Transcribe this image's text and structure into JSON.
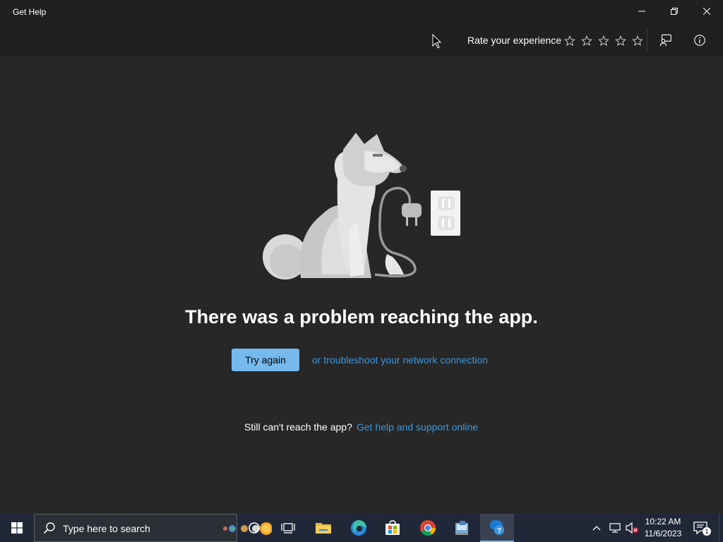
{
  "window": {
    "title": "Get Help"
  },
  "toolbar": {
    "rate_label": "Rate your experience",
    "star_count": 5,
    "stars_filled": 0
  },
  "main": {
    "error_heading": "There was a problem reaching the app.",
    "try_again_label": "Try again",
    "troubleshoot_link": "or troubleshoot your network connection",
    "still_text": "Still can't reach the app?",
    "help_online_link": "Get help and support online"
  },
  "taskbar": {
    "search_placeholder": "Type here to search",
    "clock_time": "10:22 AM",
    "clock_date": "11/6/2023",
    "notification_count": "1",
    "apps": [
      "cortana",
      "task-view",
      "file-explorer",
      "edge",
      "microsoft-store",
      "chrome",
      "control-panel",
      "get-help"
    ]
  },
  "colors": {
    "background": "#272727",
    "titlebar": "#202020",
    "accent_button": "#76b9ed",
    "link": "#3a96dd",
    "taskbar": "#202838"
  }
}
